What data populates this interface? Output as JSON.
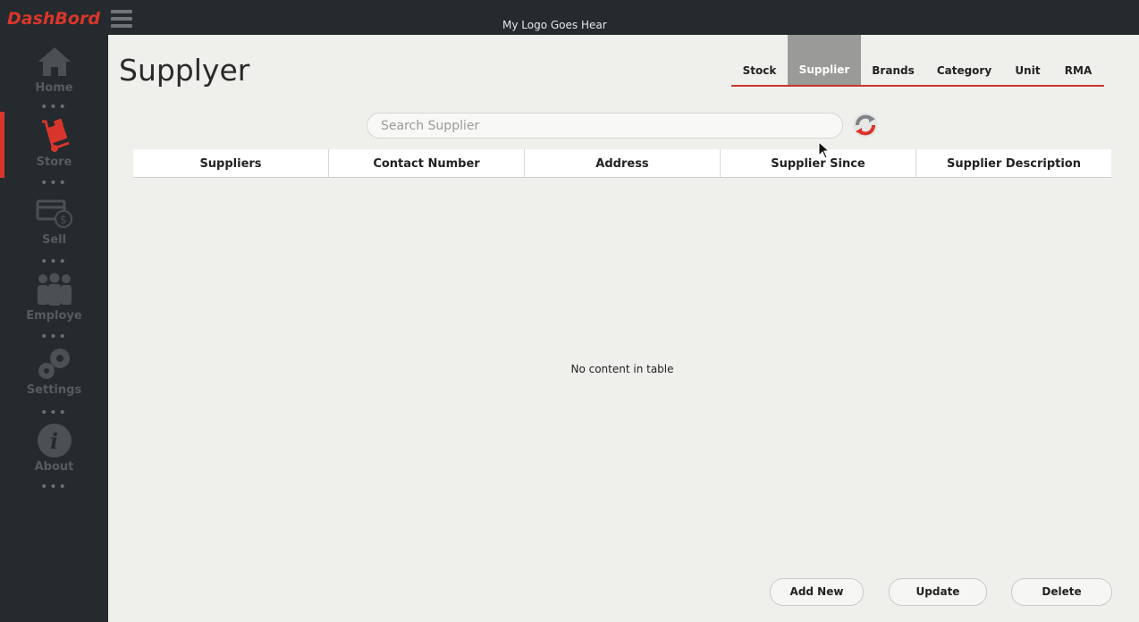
{
  "app": {
    "brand": "DashBord",
    "logo_text": "My Logo Goes Hear"
  },
  "sidebar": {
    "items": [
      {
        "label": "Home",
        "icon": "home-icon"
      },
      {
        "label": "Store",
        "icon": "hand-truck-icon"
      },
      {
        "label": "Sell",
        "icon": "cash-icon"
      },
      {
        "label": "Employe",
        "icon": "people-icon"
      },
      {
        "label": "Settings",
        "icon": "gear-icon"
      },
      {
        "label": "About",
        "icon": "info-icon"
      }
    ],
    "active_index": 1
  },
  "page": {
    "title": "Supplyer"
  },
  "tabs": [
    {
      "label": "Stock"
    },
    {
      "label": "Supplier",
      "active": true
    },
    {
      "label": "Brands"
    },
    {
      "label": "Category"
    },
    {
      "label": "Unit"
    },
    {
      "label": "RMA"
    }
  ],
  "search": {
    "placeholder": "Search Supplier",
    "value": ""
  },
  "table": {
    "columns": [
      "Suppliers",
      "Contact Number",
      "Address",
      "Supplier Since",
      "Supplier Description"
    ],
    "empty_text": "No content in table"
  },
  "actions": {
    "add_new": "Add New",
    "update": "Update",
    "delete": "Delete"
  },
  "colors": {
    "accent": "#d9362b",
    "sidebar_bg": "#242a2d",
    "main_bg": "#efefec",
    "active_tab_bg": "#9a9a98"
  }
}
